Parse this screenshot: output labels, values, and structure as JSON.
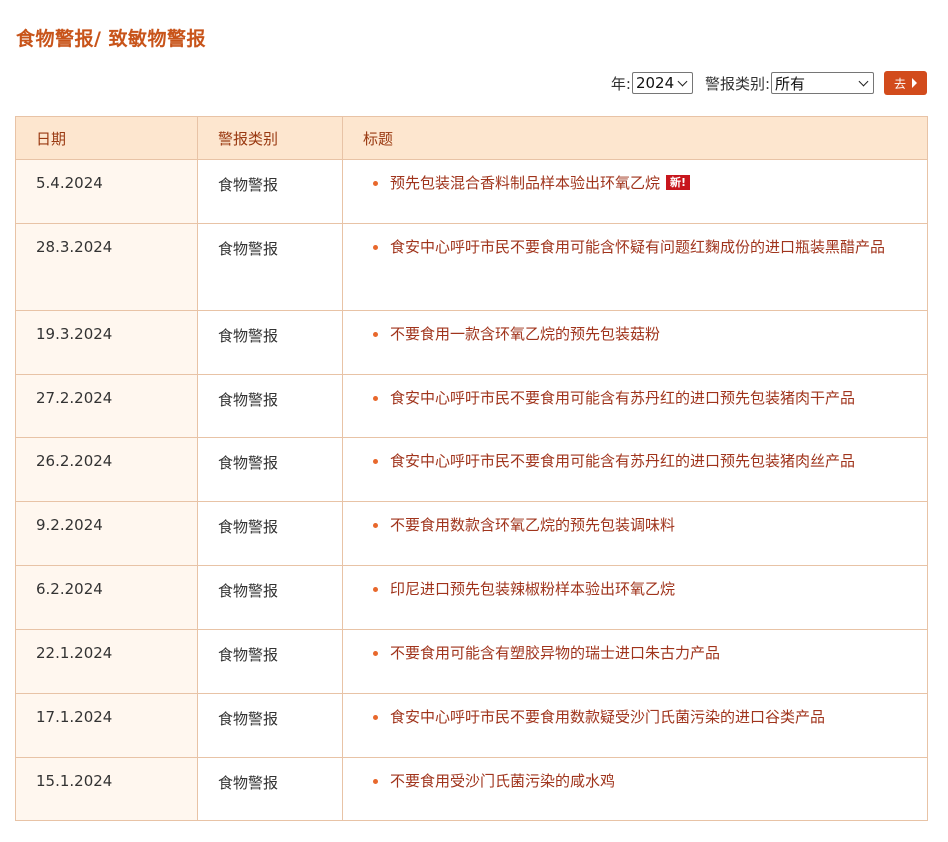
{
  "page": {
    "title": "食物警报/ 致敏物警报"
  },
  "filters": {
    "year_label": "年:",
    "year_value": "2024",
    "type_label": "警报类别:",
    "type_value": "所有",
    "go_label": "去"
  },
  "table": {
    "headers": [
      "日期",
      "警报类别",
      "标题"
    ],
    "new_badge": "新!",
    "rows": [
      {
        "date": "5.4.2024",
        "category": "食物警报",
        "title": "预先包装混合香料制品样本验出环氧乙烷",
        "is_new": true
      },
      {
        "date": "28.3.2024",
        "category": "食物警报",
        "title": "食安中心呼吁市民不要食用可能含怀疑有问题红麴成份的进口瓶装黑醋产品"
      },
      {
        "date": "19.3.2024",
        "category": "食物警报",
        "title": "不要食用一款含环氧乙烷的预先包装菇粉"
      },
      {
        "date": "27.2.2024",
        "category": "食物警报",
        "title": "食安中心呼吁市民不要食用可能含有苏丹红的进口预先包装猪肉干产品"
      },
      {
        "date": "26.2.2024",
        "category": "食物警报",
        "title": "食安中心呼吁市民不要食用可能含有苏丹红的进口预先包装猪肉丝产品"
      },
      {
        "date": "9.2.2024",
        "category": "食物警报",
        "title": "不要食用数款含环氧乙烷的预先包装调味料"
      },
      {
        "date": "6.2.2024",
        "category": "食物警报",
        "title": "印尼进口预先包装辣椒粉样本验出环氧乙烷"
      },
      {
        "date": "22.1.2024",
        "category": "食物警报",
        "title": "不要食用可能含有塑胶异物的瑞士进口朱古力产品"
      },
      {
        "date": "17.1.2024",
        "category": "食物警报",
        "title": "食安中心呼吁市民不要食用数款疑受沙门氏菌污染的进口谷类产品"
      },
      {
        "date": "15.1.2024",
        "category": "食物警报",
        "title": "不要食用受沙门氏菌污染的咸水鸡"
      }
    ]
  },
  "colors": {
    "accent": "#c8541a",
    "header_bg": "#fde6cf",
    "date_col_bg": "#fff7ef",
    "border": "#e8c3a6",
    "link": "#a0341c",
    "bullet": "#e8682c",
    "badge": "#c8161d",
    "button": "#d24b1c"
  }
}
